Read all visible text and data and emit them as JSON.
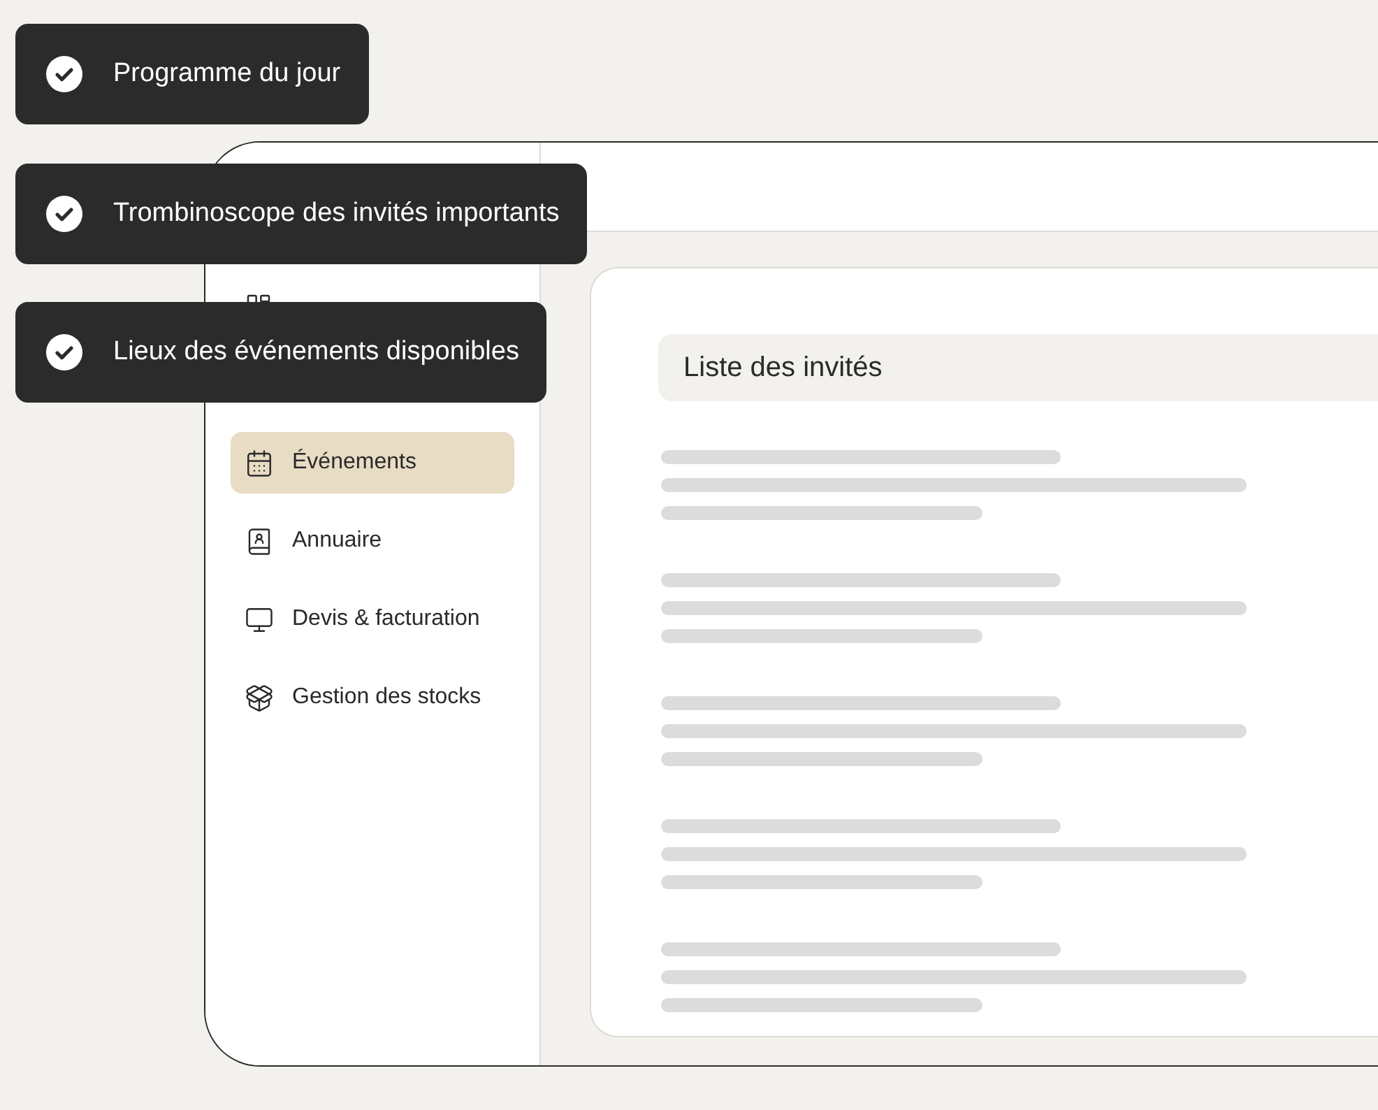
{
  "badges": [
    {
      "label": "Programme du jour"
    },
    {
      "label": "Trombinoscope des invités importants"
    },
    {
      "label": "Lieux des événements disponibles"
    }
  ],
  "sidebar": {
    "items": [
      {
        "label": "Événements",
        "selected": true
      },
      {
        "label": "Annuaire",
        "selected": false
      },
      {
        "label": "Devis & facturation",
        "selected": false
      },
      {
        "label": "Gestion des stocks",
        "selected": false
      }
    ]
  },
  "card": {
    "title": "Liste des invités"
  }
}
